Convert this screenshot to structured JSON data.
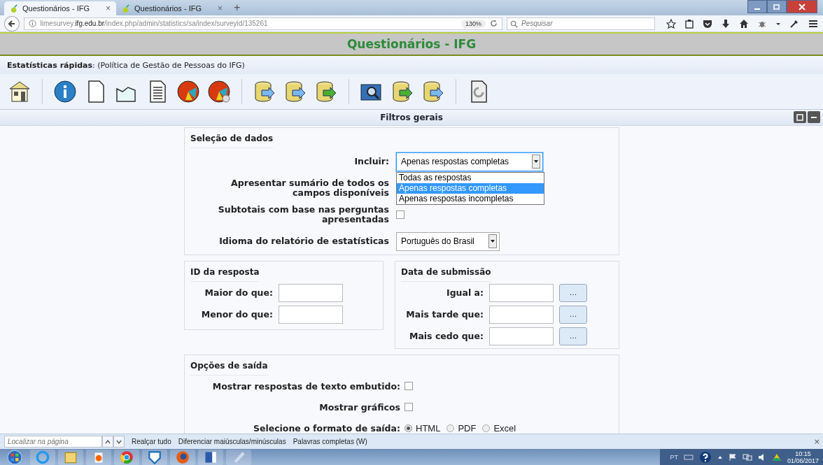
{
  "browser": {
    "tabs": [
      {
        "title": "Questionários - IFG",
        "selected": true,
        "close": "×"
      },
      {
        "title": "Questionários - IFG",
        "selected": false,
        "close": "×"
      }
    ],
    "new_tab": "+",
    "url": {
      "prefix": "limesurvey.",
      "domain": "ifg.edu.br",
      "path": "/index.php/admin/statistics/sa/index/surveyid/135261"
    },
    "zoom": "130%",
    "search_placeholder": "Pesquisar"
  },
  "site_title": "Questionários - IFG",
  "subtitle": "**Estatísticas rápidas**: (Política de Gestão de Pessoas do IFG)",
  "filters_title": "Filtros gerais",
  "data_selection": {
    "legend": "Seleção de dados",
    "include": {
      "label": "Incluir:",
      "value": "Apenas respostas completas",
      "expanded": true,
      "options": [
        {
          "label": "Todas as respostas",
          "selected": false
        },
        {
          "label": "Apenas respostas completas",
          "selected": true
        },
        {
          "label": "Apenas respostas incompletas",
          "selected": false
        }
      ]
    },
    "summary": {
      "label": "Apresentar sumário de todos os campos disponíveis"
    },
    "subtotals": {
      "label": "Subtotais com base nas perguntas apresentadas",
      "checked": false
    },
    "language": {
      "label": "Idioma do relatório de estatísticas",
      "value": "Português do Brasil"
    }
  },
  "response_id": {
    "legend": "ID da resposta",
    "fields": [
      {
        "label": "Maior do que:"
      },
      {
        "label": "Menor do que:"
      }
    ]
  },
  "submission_date": {
    "legend": "Data de submissão",
    "fields": [
      {
        "label": "Igual a:",
        "button": "..."
      },
      {
        "label": "Mais tarde que:",
        "button": "..."
      },
      {
        "label": "Mais cedo que:",
        "button": "..."
      }
    ]
  },
  "output_options": {
    "legend": "Opções de saída",
    "options": [
      {
        "kind": "checkbox",
        "label": "Mostrar respostas de texto embutido:",
        "checked": false
      },
      {
        "kind": "checkbox",
        "label": "Mostrar gráficos",
        "checked": false
      },
      {
        "kind": "radio",
        "label": "Selecione o formato de saída:",
        "choices": [
          {
            "label": "HTML",
            "selected": true
          },
          {
            "label": "PDF",
            "selected": false
          },
          {
            "label": "Excel",
            "selected": false
          }
        ]
      }
    ]
  },
  "find_bar": {
    "placeholder": "Localizar na página",
    "actions": [
      "Realçar tudo",
      "Diferenciar maiúsculas/minúsculas",
      "Palavras completas (W)"
    ],
    "close": "×"
  },
  "taskbar": {
    "language": "PT",
    "time": "10:15",
    "date": "01/06/2017"
  }
}
